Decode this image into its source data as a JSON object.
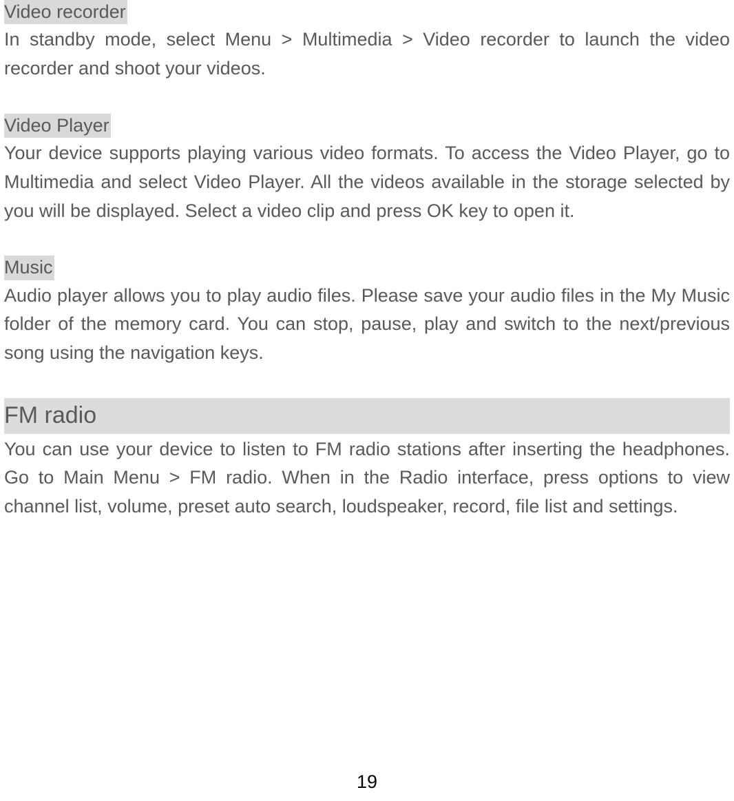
{
  "sections": [
    {
      "heading": "Video recorder",
      "body": "In standby mode, select Menu > Multimedia > Video recorder to launch the video recorder and shoot your videos."
    },
    {
      "heading": "Video Player",
      "body": "Your device supports playing various video formats. To access the Video Player, go to Multimedia and select Video Player. All the videos available in the storage selected by you will be displayed.  Select a video clip and press OK key to open it."
    },
    {
      "heading": "Music",
      "body": "Audio player allows you to play audio files. Please save your audio files in the My Music folder of the memory card. You can stop, pause, play and switch to the next/previous song using the navigation keys."
    }
  ],
  "fm_radio": {
    "heading": "FM radio",
    "body": "You can use your device to listen to FM radio stations after inserting the headphones. Go to Main Menu >  FM radio. When in the Radio interface, press options to view channel list, volume, preset auto search, loudspeaker, record, file list and settings."
  },
  "page_number": "19"
}
